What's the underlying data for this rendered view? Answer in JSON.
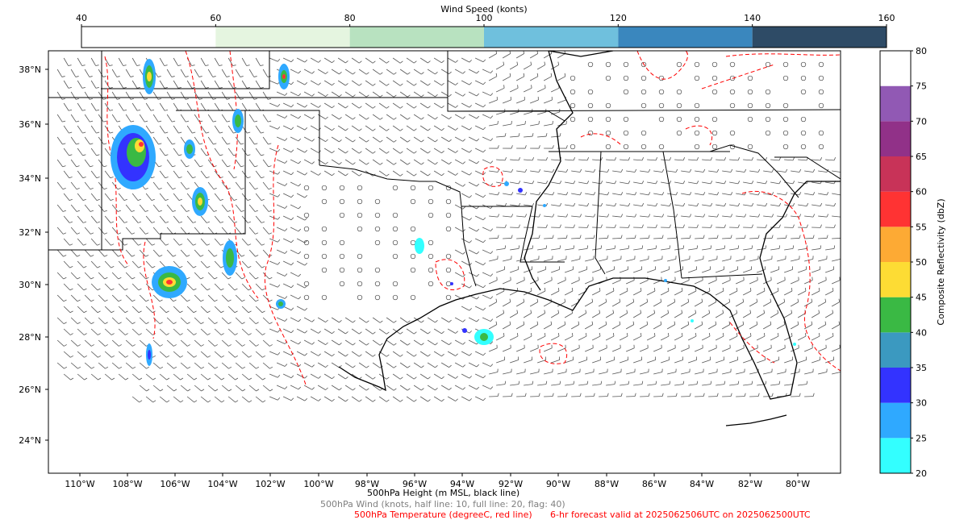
{
  "wind_colorbar": {
    "title": "Wind Speed (konts)",
    "ticks": [
      "40",
      "60",
      "80",
      "100",
      "120",
      "140",
      "160"
    ],
    "colors": [
      "#ffffff",
      "#e5f5e0",
      "#b8e2c0",
      "#6fc0dd",
      "#3a87be",
      "#2e4b66"
    ]
  },
  "reflectivity_colorbar": {
    "title": "Composite Reflectivity (dbZ)",
    "ticks": [
      "20",
      "25",
      "30",
      "35",
      "40",
      "45",
      "50",
      "55",
      "60",
      "65",
      "70",
      "75",
      "80"
    ],
    "colors": [
      "#33ffff",
      "#2fa9ff",
      "#3333ff",
      "#3b99c0",
      "#3ab944",
      "#fddc34",
      "#fdaa34",
      "#ff3333",
      "#c83358",
      "#913188",
      "#9159b4",
      "#ffffff"
    ]
  },
  "map": {
    "lat_labels": [
      "38°N",
      "36°N",
      "34°N",
      "32°N",
      "30°N",
      "28°N",
      "26°N",
      "24°N"
    ],
    "lon_labels": [
      "110°W",
      "108°W",
      "106°W",
      "104°W",
      "102°W",
      "100°W",
      "98°W",
      "96°W",
      "94°W",
      "92°W",
      "90°W",
      "88°W",
      "86°W",
      "84°W",
      "82°W",
      "80°W"
    ],
    "colors": {
      "coast": "#000000",
      "state_line": "#000000",
      "temp_contour": "#ff0000",
      "barb": "#555555"
    }
  },
  "captions": {
    "height": "500hPa Height (m MSL, black line)",
    "wind": "500hPa Wind (knots, half line: 10, full line: 20, flag: 40)",
    "temperature": "500hPa Temperature (degreeC, red line)",
    "valid": "6-hr forecast valid at 2025062506UTC on 2025062500UTC"
  }
}
